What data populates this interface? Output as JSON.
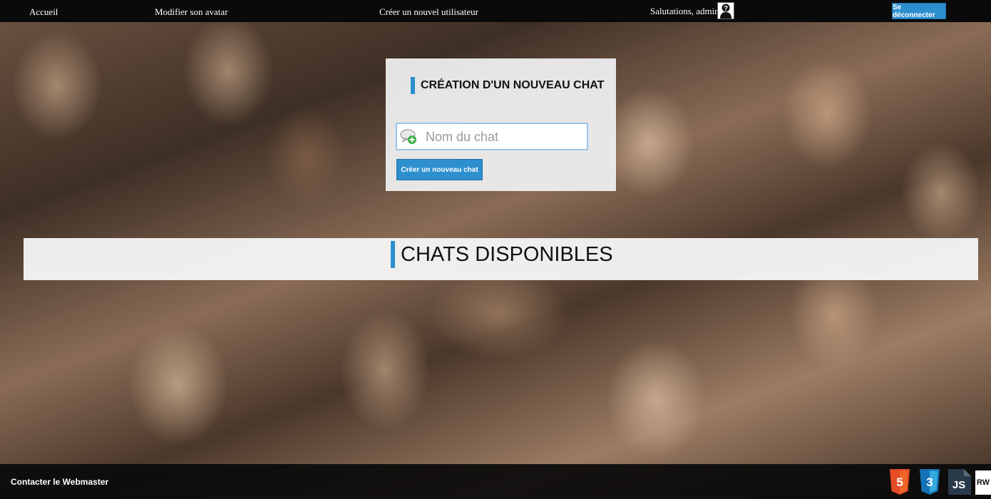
{
  "nav": {
    "home_label": "Accueil",
    "avatar_label": "Modifier son avatar",
    "new_user_label": "Créer un nouvel utilisateur",
    "greeting": "Salutations, admin",
    "logout_label": "Se déconnecter"
  },
  "create_chat": {
    "title": "CRÉATION D'UN NOUVEAU CHAT",
    "input_placeholder": "Nom du chat",
    "input_value": "",
    "submit_label": "Créer un nouveau chat"
  },
  "available_chats": {
    "title": "CHATS DISPONIBLES"
  },
  "footer": {
    "contact_label": "Contacter le Webmaster",
    "tech_badges": [
      "HTML5",
      "CSS3",
      "JS",
      "RW"
    ]
  },
  "colors": {
    "accent": "#2d8fce",
    "topbar": "#0a0a0a",
    "html5": "#e44d26",
    "css3": "#1572b6",
    "js": "#2b3a4a"
  }
}
